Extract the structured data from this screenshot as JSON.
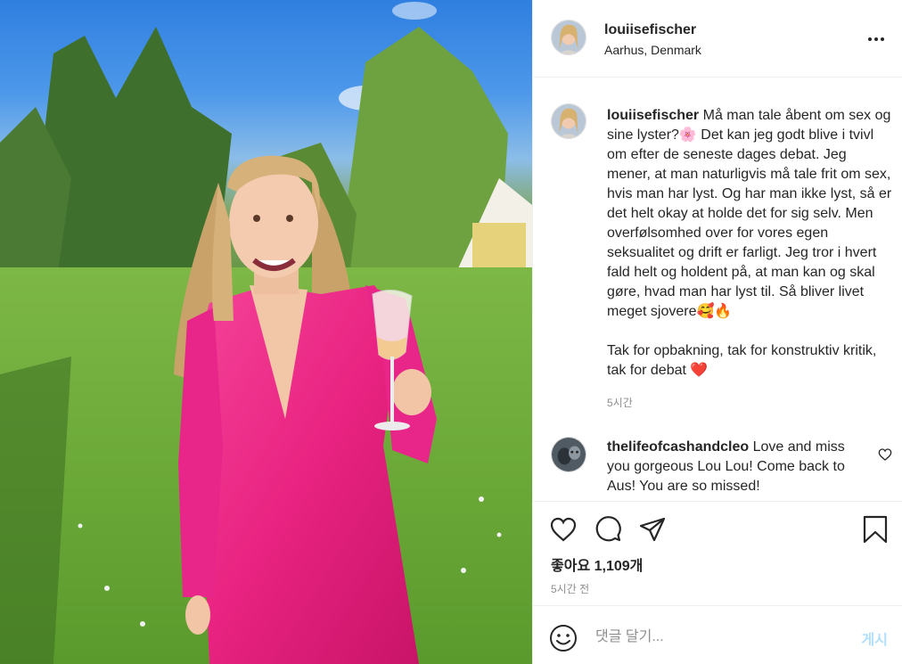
{
  "post": {
    "username": "louiisefischer",
    "location": "Aarhus, Denmark"
  },
  "caption": {
    "username": "louiisefischer",
    "text": "Må man tale åbent om sex og sine lyster?🌸 Det kan jeg godt blive i tvivl om efter de seneste dages debat. Jeg mener, at man naturligvis må tale frit om sex, hvis man har lyst. Og har man ikke lyst, så er det helt okay at holde det for sig selv. Men overfølsomhed over for vores egen seksualitet og drift er farligt. Jeg tror i hvert fald helt og holdent på, at man kan og skal gøre, hvad man har lyst til. Så bliver livet meget sjovere🥰🔥\n\nTak for opbakning, tak for konstruktiv kritik, tak for debat ❤️",
    "time": "5시간"
  },
  "comments": [
    {
      "username": "thelifeofcashandcleo",
      "text": "Love and miss you gorgeous Lou Lou! Come back to Aus! You are so missed!"
    }
  ],
  "actions": {
    "likes": "좋아요 1,109개",
    "time": "5시간 전"
  },
  "add_comment": {
    "placeholder": "댓글 달기...",
    "post_label": "게시"
  },
  "icons": {
    "more": "more-options-icon",
    "heart": "heart-icon",
    "comment": "comment-icon",
    "share": "share-icon",
    "save": "bookmark-icon",
    "emoji": "emoji-icon",
    "comment_like": "small-heart-icon"
  },
  "colors": {
    "dress": "#f0318a",
    "post_button_disabled": "#b2dffc",
    "secondary_text": "#8e8e8e",
    "border": "#efefef"
  }
}
